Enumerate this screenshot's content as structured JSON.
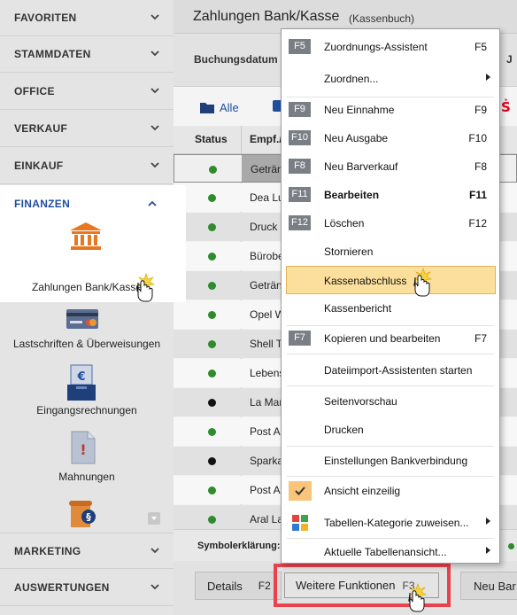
{
  "sidebar": {
    "sections": [
      {
        "label": "FAVORITEN"
      },
      {
        "label": "STAMMDATEN"
      },
      {
        "label": "OFFICE"
      },
      {
        "label": "VERKAUF"
      },
      {
        "label": "EINKAUF"
      }
    ],
    "active_section": "FINANZEN",
    "tiles": [
      {
        "label": "Zahlungen Bank/Kasse"
      },
      {
        "label": "Lastschriften & Überweisungen"
      },
      {
        "label": "Eingangsrechnungen"
      },
      {
        "label": "Mahnungen"
      }
    ],
    "bottom_sections": [
      {
        "label": "MARKETING"
      },
      {
        "label": "AUSWERTUNGEN"
      }
    ]
  },
  "header": {
    "title": "Zahlungen Bank/Kasse",
    "subtitle": "(Kassenbuch)"
  },
  "filter": {
    "label": "Buchungsdatum",
    "truncated": "J"
  },
  "tabs": [
    {
      "label": "Alle"
    }
  ],
  "table": {
    "columns": [
      "Status",
      "Empf./"
    ],
    "rows": [
      {
        "status": "green",
        "empf": "Getränk"
      },
      {
        "status": "green",
        "empf": "Dea Lu"
      },
      {
        "status": "green",
        "empf": "Druck"
      },
      {
        "status": "green",
        "empf": "Bürobe"
      },
      {
        "status": "green",
        "empf": "Getränk"
      },
      {
        "status": "green",
        "empf": "Opel W"
      },
      {
        "status": "green",
        "empf": "Shell T"
      },
      {
        "status": "green",
        "empf": "Lebens"
      },
      {
        "status": "black",
        "empf": "La Mar"
      },
      {
        "status": "green",
        "empf": "Post A"
      },
      {
        "status": "black",
        "empf": "Sparka"
      },
      {
        "status": "green",
        "empf": "Post A"
      },
      {
        "status": "green",
        "empf": "Aral La"
      }
    ]
  },
  "legend": {
    "label": "Symbolerklärung:"
  },
  "bottom_buttons": {
    "details": "Details",
    "details_key": "F2",
    "weitere": "Weitere Funktionen",
    "weitere_key": "F3",
    "neu": "Neu Bar"
  },
  "menu": {
    "items": [
      {
        "key": "F5",
        "label": "Zuordnungs-Assistent",
        "shortcut": "F5"
      },
      {
        "key": "",
        "label": "Zuordnen...",
        "shortcut": "",
        "submenu": true
      },
      {
        "key": "F9",
        "label": "Neu Einnahme",
        "shortcut": "F9"
      },
      {
        "key": "F10",
        "label": "Neu Ausgabe",
        "shortcut": "F10"
      },
      {
        "key": "F8",
        "label": "Neu Barverkauf",
        "shortcut": "F8"
      },
      {
        "key": "F11",
        "label": "Bearbeiten",
        "shortcut": "F11",
        "bold": true
      },
      {
        "key": "F12",
        "label": "Löschen",
        "shortcut": "F12"
      },
      {
        "key": "",
        "label": "Stornieren",
        "shortcut": ""
      },
      {
        "key": "",
        "label": "Kassenabschluss",
        "shortcut": "",
        "highlighted": true
      },
      {
        "key": "",
        "label": "Kassenbericht",
        "shortcut": ""
      },
      {
        "key": "F7",
        "label": "Kopieren und bearbeiten",
        "shortcut": "F7"
      },
      {
        "key": "",
        "label": "Dateiimport-Assistenten starten",
        "shortcut": ""
      },
      {
        "key": "",
        "label": "Seitenvorschau",
        "shortcut": ""
      },
      {
        "key": "",
        "label": "Drucken",
        "shortcut": ""
      },
      {
        "key": "",
        "label": "Einstellungen Bankverbindung",
        "shortcut": ""
      },
      {
        "key": "",
        "label": "Ansicht einzeilig",
        "shortcut": "",
        "checked": true
      },
      {
        "key": "",
        "label": "Tabellen-Kategorie zuweisen...",
        "shortcut": "",
        "submenu": true
      },
      {
        "key": "",
        "label": "Aktuelle Tabellenansicht...",
        "shortcut": "",
        "submenu": true
      }
    ]
  },
  "colors": {
    "accent_blue": "#1f4e9e",
    "status_green": "#2e8b2e",
    "highlight_red": "#e9424c",
    "menu_highlight": "#fcdf9c",
    "key_badge": "#7a7e85"
  }
}
